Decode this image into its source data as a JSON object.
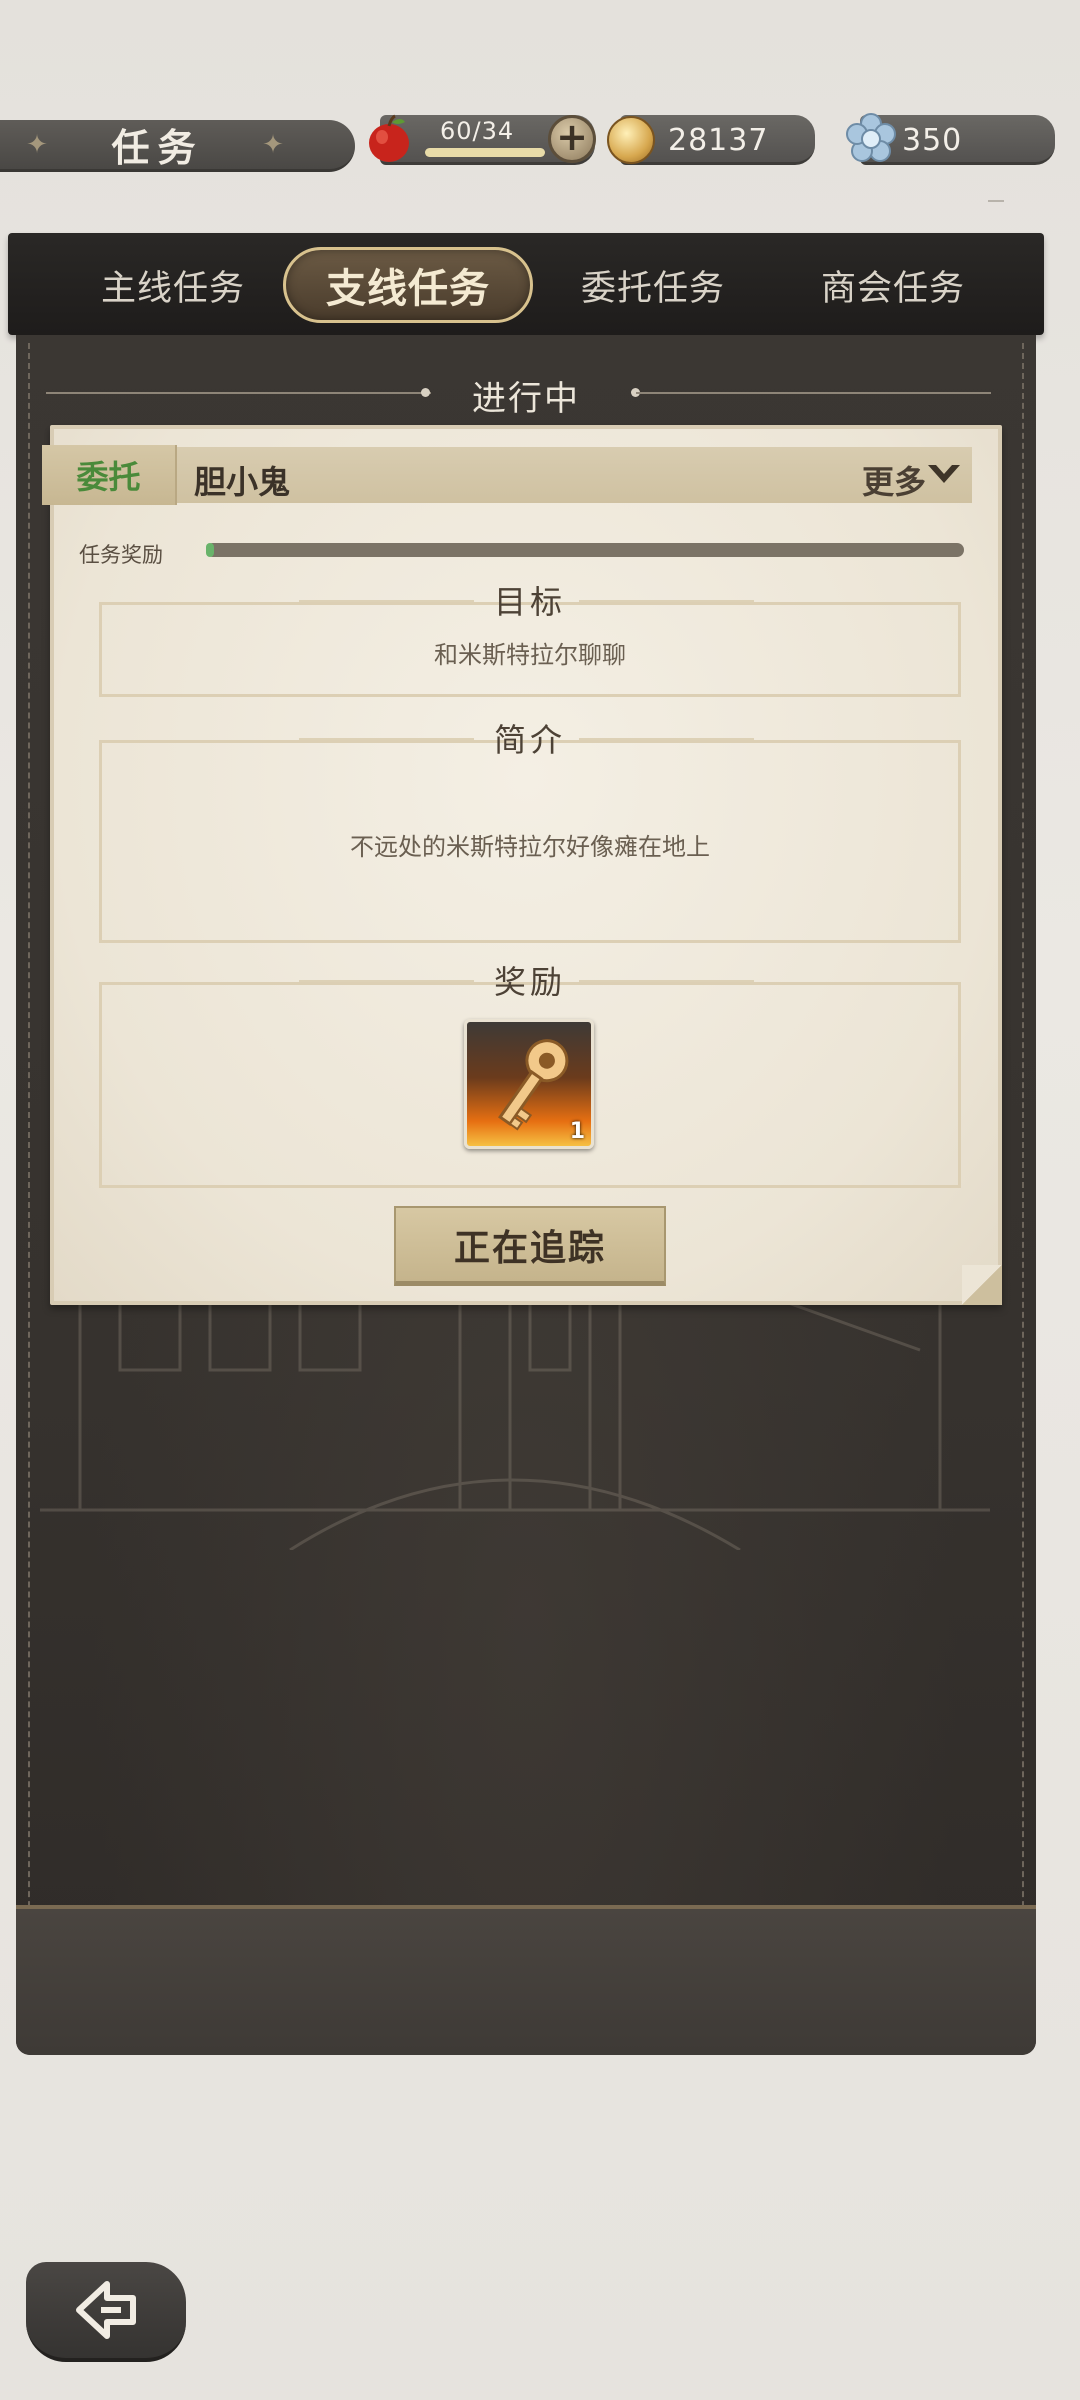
{
  "header": {
    "title": "任务",
    "stamina": {
      "text": "60/34",
      "fill": 1.0
    },
    "gold": "28137",
    "gems": "350"
  },
  "tabs": [
    {
      "label": "主线任务",
      "active": false
    },
    {
      "label": "支线任务",
      "active": true
    },
    {
      "label": "委托任务",
      "active": false
    },
    {
      "label": "商会任务",
      "active": false
    }
  ],
  "section_status": "进行中",
  "quest": {
    "tag": "委托",
    "name": "胆小鬼",
    "more": "更多",
    "reward_progress_label": "任务奖励",
    "reward_progress": 0.01,
    "goal_title": "目标",
    "goal_text": "和米斯特拉尔聊聊",
    "intro_title": "简介",
    "intro_text": "不远处的米斯特拉尔好像瘫在地上",
    "reward_title": "奖励",
    "reward_item_count": "1",
    "reward_item_icon": "golden-key-icon",
    "track_button": "正在追踪"
  },
  "colors": {
    "accent_green": "#4a8a3a",
    "progress_green": "#69b36a",
    "active_tab_border": "#d8c28e"
  }
}
